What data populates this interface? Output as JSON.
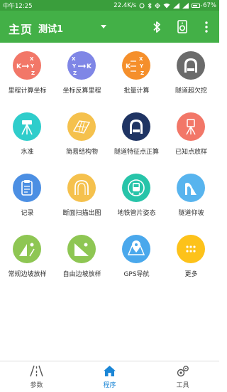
{
  "status_bar": {
    "time": "中午12:25",
    "network_speed": "22.4K/s",
    "battery_percent": "67%"
  },
  "app_bar": {
    "title": "主页",
    "project": "测试1"
  },
  "grid": {
    "items": [
      {
        "label": "里程计算坐标",
        "color": "#f27768",
        "icon": "kxyz-mileage-to-coord-icon"
      },
      {
        "label": "坐标反算里程",
        "color": "#7f86e6",
        "icon": "xyz-k-coord-to-mileage-icon"
      },
      {
        "label": "批量计算",
        "color": "#f58f2b",
        "icon": "batch-kxyz-icon"
      },
      {
        "label": "隧道超欠挖",
        "color": "#6b6b6b",
        "icon": "tunnel-overbreak-icon"
      },
      {
        "label": "水准",
        "color": "#2fcdcb",
        "icon": "level-tripod-icon"
      },
      {
        "label": "简易结构物",
        "color": "#f5c14d",
        "icon": "structure-grid-icon"
      },
      {
        "label": "隧道特征点正算",
        "color": "#1f3463",
        "icon": "tunnel-feature-point-icon"
      },
      {
        "label": "已知点放样",
        "color": "#f27768",
        "icon": "total-station-icon"
      },
      {
        "label": "记录",
        "color": "#4c8fe3",
        "icon": "clipboard-icon"
      },
      {
        "label": "断面扫描出图",
        "color": "#f5c14d",
        "icon": "tunnel-scan-icon"
      },
      {
        "label": "地铁管片姿态",
        "color": "#27c4a9",
        "icon": "metro-train-icon"
      },
      {
        "label": "隧道仰坡",
        "color": "#58b4ee",
        "icon": "tunnel-slope-icon"
      },
      {
        "label": "常规边坡放样",
        "color": "#8ec653",
        "icon": "slope-stakeout-icon"
      },
      {
        "label": "自由边坡放样",
        "color": "#8ec653",
        "icon": "free-slope-icon"
      },
      {
        "label": "GPS导航",
        "color": "#4aa8ec",
        "icon": "gps-map-icon"
      },
      {
        "label": "更多",
        "color": "#fdc21a",
        "icon": "more-dots-icon"
      }
    ]
  },
  "tab_bar": {
    "tabs": [
      {
        "label": "参数",
        "icon": "road-icon"
      },
      {
        "label": "程序",
        "icon": "home-icon",
        "active": true
      },
      {
        "label": "工具",
        "icon": "gears-icon"
      }
    ],
    "active_color": "#1b86d6"
  }
}
